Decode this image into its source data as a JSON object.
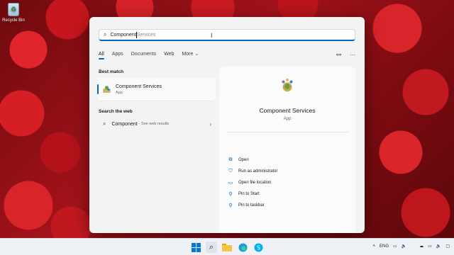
{
  "desktop": {
    "recycle_bin_label": "Recycle Bin"
  },
  "search": {
    "typed": "Component",
    "suggestion": " Services"
  },
  "filters": [
    "All",
    "Apps",
    "Documents",
    "Web",
    "More"
  ],
  "filters_more_chevron": "⌄",
  "best_match": {
    "section_label": "Best match",
    "title": "Component Services",
    "subtitle": "App"
  },
  "web": {
    "section_label": "Search the web",
    "query": "Component",
    "note": "- See web results"
  },
  "details": {
    "title": "Component Services",
    "subtitle": "App",
    "actions": [
      {
        "label": "Open",
        "icon": "open-icon"
      },
      {
        "label": "Run as administrator",
        "icon": "shield-icon"
      },
      {
        "label": "Open file location",
        "icon": "folder-icon"
      },
      {
        "label": "Pin to Start",
        "icon": "pin-icon"
      },
      {
        "label": "Pin to taskbar",
        "icon": "pin-icon"
      }
    ]
  },
  "tray": {
    "language": "ENG"
  },
  "colors": {
    "accent": "#0067c0"
  }
}
